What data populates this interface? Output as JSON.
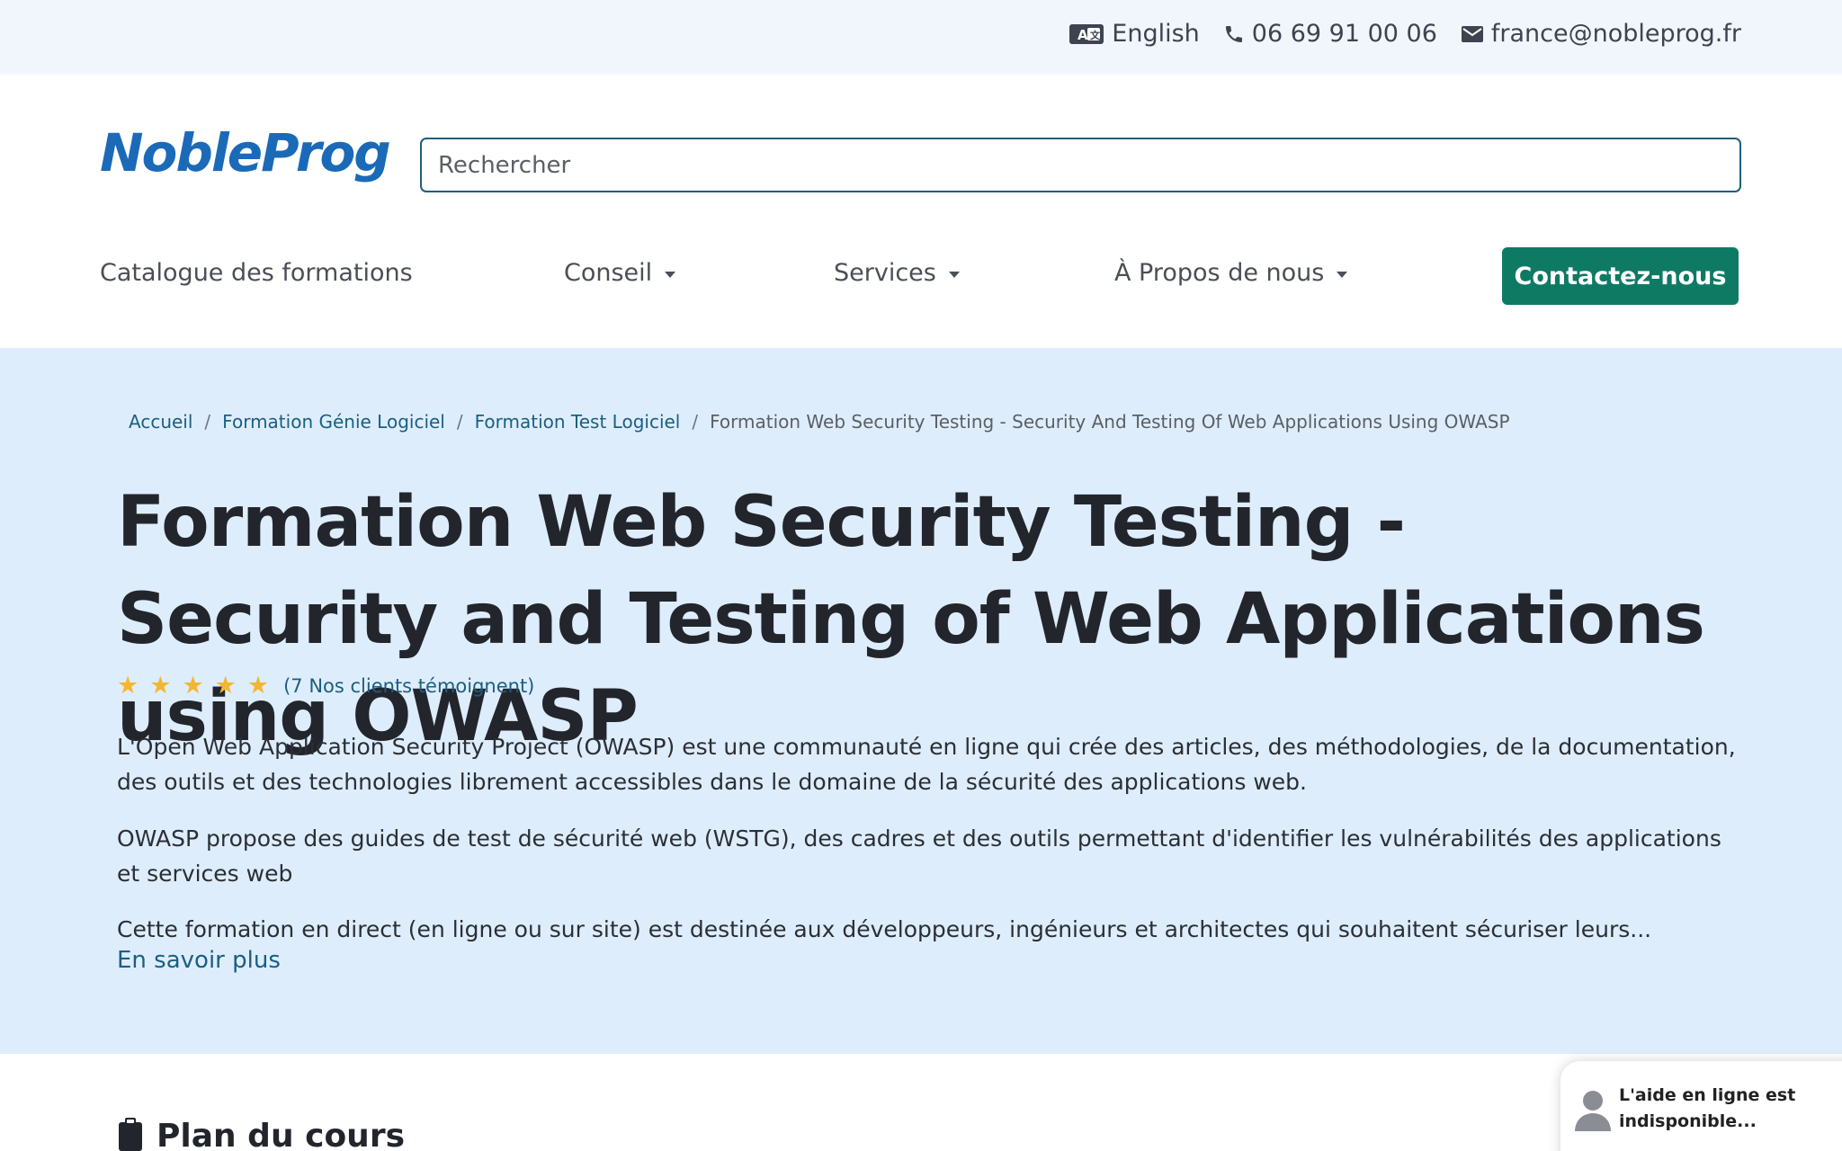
{
  "topbar": {
    "language": "English",
    "phone": "06 69 91 00 06",
    "email": "france@nobleprog.fr"
  },
  "header": {
    "logo": "NobleProg",
    "search_placeholder": "Rechercher"
  },
  "nav": {
    "items": [
      {
        "label": "Catalogue des formations",
        "dropdown": false
      },
      {
        "label": "Conseil",
        "dropdown": true
      },
      {
        "label": "Services",
        "dropdown": true
      },
      {
        "label": "À Propos de nous",
        "dropdown": true
      }
    ],
    "contact_button": "Contactez-nous"
  },
  "breadcrumb": [
    "Accueil",
    "Formation Génie Logiciel",
    "Formation Test Logiciel",
    "Formation Web Security Testing - Security And Testing Of Web Applications Using OWASP"
  ],
  "hero": {
    "title": "Formation Web Security Testing - Security and Testing of Web Applications using OWASP",
    "rating_stars": 5,
    "rating_text": "(7 Nos clients témoignent)",
    "paragraphs": [
      "L'Open Web Application Security Project (OWASP) est une communauté en ligne qui crée des articles, des méthodologies, de la documentation, des outils et des technologies librement accessibles dans le domaine de la sécurité des applications web.",
      "OWASP propose des guides de test de sécurité web (WSTG), des cadres et des outils permettant d'identifier les vulnérabilités des applications et services web",
      "Cette formation en direct (en ligne ou sur site) est destinée aux développeurs, ingénieurs et architectes qui souhaitent sécuriser leurs..."
    ],
    "read_more": "En savoir plus"
  },
  "plan": {
    "title": "Plan du cours"
  },
  "chat": {
    "text": "L'aide en ligne est indisponible..."
  },
  "colors": {
    "brand_blue": "#1a6ab8",
    "contact_green": "#0f7a64",
    "hero_bg": "#deedfc",
    "topbar_bg": "#f1f6fd",
    "link": "#1a5f82",
    "star": "#f2b632"
  },
  "icons": [
    "translate-icon",
    "phone-icon",
    "mail-icon",
    "star-icon",
    "caret-down-icon",
    "clipboard-icon",
    "user-avatar-icon"
  ]
}
